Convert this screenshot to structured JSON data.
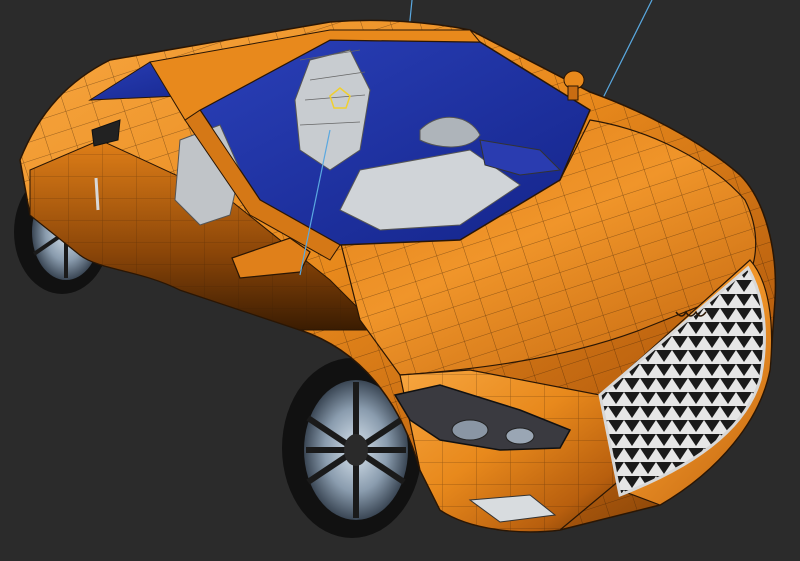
{
  "scene": {
    "background_color": "#2b2b2b",
    "body_color": "#e8891c",
    "body_shadow_color": "#7a3e06",
    "wire_color": "#2a1604",
    "glass_color": "#1b2fa0",
    "interior_color": "#c8ccd0",
    "grille_color": "#e6e6e6",
    "guide_line_color": "#5aa8e0",
    "helper_gizmo_color": "#f0d030",
    "tire_color": "#111111",
    "rim_color": "#a8b8c8",
    "grille_pattern": "sawtooth"
  }
}
